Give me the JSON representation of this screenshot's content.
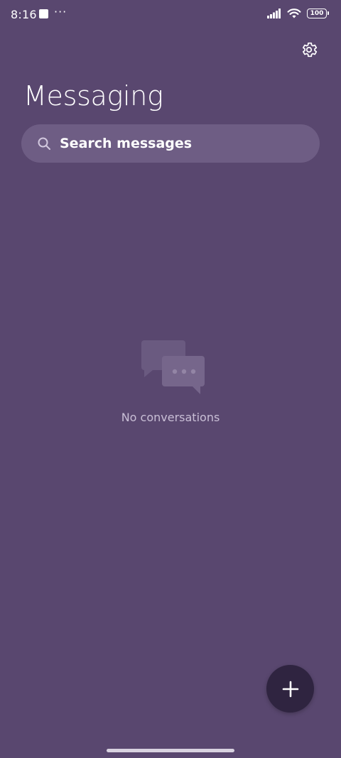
{
  "status_bar": {
    "time": "8:16",
    "notification_dots": "···",
    "battery_level": "100",
    "icons": [
      "notification-square-icon",
      "signal-icon",
      "wifi-icon",
      "battery-icon"
    ]
  },
  "header": {
    "title": "Messaging",
    "settings_icon": "gear-icon"
  },
  "search": {
    "placeholder": "Search messages",
    "value": "",
    "icon": "search-icon"
  },
  "empty_state": {
    "icon": "chat-bubbles-icon",
    "text": "No conversations"
  },
  "fab": {
    "icon": "plus-icon"
  },
  "colors": {
    "background": "#59476F",
    "search_background": "#6E5D84",
    "fab_background": "#2F2440",
    "muted_text": "#C9BFD6"
  }
}
